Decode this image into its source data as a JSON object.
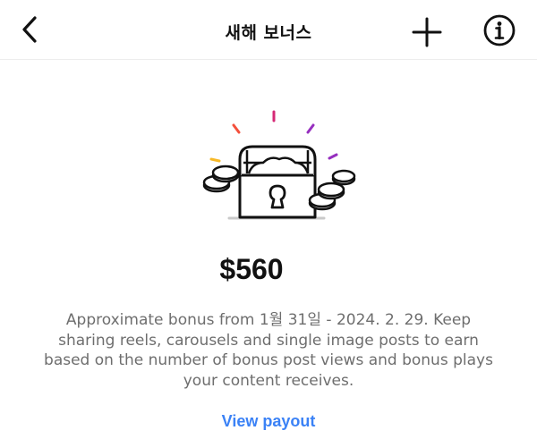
{
  "header": {
    "title": "새해 보너스",
    "back_icon": "chevron-left-icon",
    "add_icon": "plus-icon",
    "info_icon": "info-circle-icon"
  },
  "bonus": {
    "illustration": "locked-treasure-chest-with-coins",
    "amount": "$560",
    "description": "Approximate bonus from 1월 31일 - 2024. 2. 29. Keep sharing reels, carousels and single image posts to earn based on the number of bonus post views and bonus plays your content receives.",
    "link_label": "View payout"
  },
  "colors": {
    "link": "#3b82f6",
    "body_text": "#6e6e6e",
    "sparkle_red": "#f4503c",
    "sparkle_magenta": "#d62976",
    "sparkle_purple": "#962fbf",
    "sparkle_yellow": "#f7b928"
  }
}
